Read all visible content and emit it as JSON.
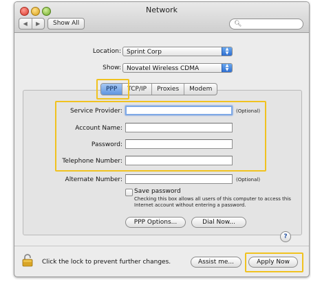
{
  "window": {
    "title": "Network"
  },
  "toolbar": {
    "back": "◀",
    "forward": "▶",
    "show_all_label": "Show All",
    "search_placeholder": ""
  },
  "location": {
    "label": "Location:",
    "value": "Sprint Corp"
  },
  "show": {
    "label": "Show:",
    "value": "Novatel Wireless CDMA"
  },
  "tabs": [
    {
      "label": "PPP",
      "active": true
    },
    {
      "label": "TCP/IP",
      "active": false
    },
    {
      "label": "Proxies",
      "active": false
    },
    {
      "label": "Modem",
      "active": false
    }
  ],
  "form": {
    "service_provider": {
      "label": "Service Provider:",
      "value": "",
      "note": "(Optional)"
    },
    "account_name": {
      "label": "Account Name:",
      "value": ""
    },
    "password": {
      "label": "Password:",
      "value": ""
    },
    "telephone_number": {
      "label": "Telephone Number:",
      "value": ""
    },
    "alternate_number": {
      "label": "Alternate Number:",
      "value": "",
      "note": "(Optional)"
    },
    "save_password": {
      "label": "Save password",
      "checked": false,
      "help": "Checking this box allows all users of this computer to access this Internet account without entering a password."
    }
  },
  "buttons": {
    "ppp_options": "PPP Options...",
    "dial_now": "Dial Now...",
    "help": "?",
    "assist_me": "Assist me...",
    "apply_now": "Apply Now"
  },
  "footer": {
    "lock_text": "Click the lock to prevent further changes."
  },
  "colors": {
    "highlight": "#f0c21f",
    "accent": "#5f95e0"
  }
}
